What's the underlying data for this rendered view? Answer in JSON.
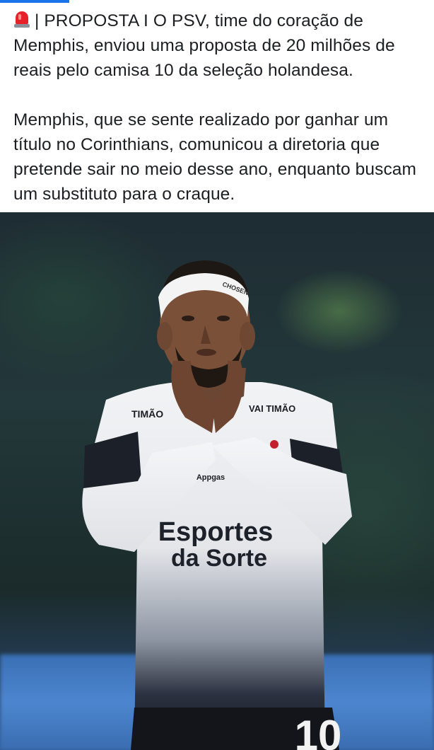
{
  "post": {
    "paragraph1": "| PROPOSTA I O PSV, time do coração de Memphis, enviou uma proposta de 20 milhões de reais pelo camisa 10 da seleção holandesa.",
    "paragraph2": "Memphis, que se sente realizado por ganhar um título no Corinthians, comunicou a diretoria que pretende sair no meio desse ano, enquanto buscam um substituto para o craque.",
    "emoji_icon": "siren-icon"
  },
  "photo": {
    "headband_text": "CHOSEN",
    "chest_left_text": "TIMÃO",
    "chest_right_text": "VAI TIMÃO",
    "sponsor_small": "Appgas",
    "sponsor_line1": "Esportes",
    "sponsor_line2": "da Sorte",
    "number": "10"
  },
  "colors": {
    "text": "#1c1e21",
    "accent": "#1a73e8",
    "siren_red": "#e8202a"
  }
}
